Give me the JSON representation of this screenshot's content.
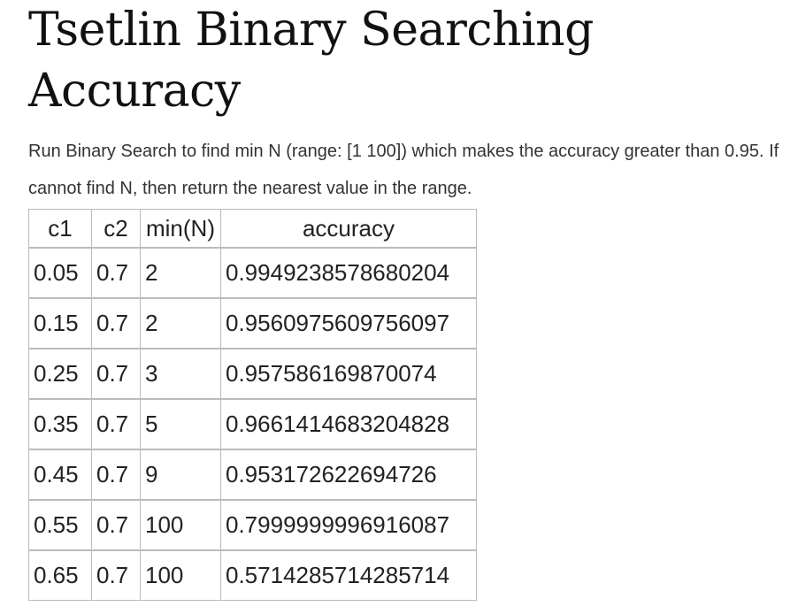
{
  "page": {
    "title": "Tsetlin Binary Searching Accuracy",
    "description": "Run Binary Search to find min N (range: [1 100]) which makes the accuracy greater than 0.95. If cannot find N, then return the nearest value in the range."
  },
  "table": {
    "headers": [
      "c1",
      "c2",
      "min(N)",
      "accuracy"
    ],
    "rows": [
      [
        "0.05",
        "0.7",
        "2",
        "0.9949238578680204"
      ],
      [
        "0.15",
        "0.7",
        "2",
        "0.9560975609756097"
      ],
      [
        "0.25",
        "0.7",
        "3",
        "0.957586169870074"
      ],
      [
        "0.35",
        "0.7",
        "5",
        "0.9661414683204828"
      ],
      [
        "0.45",
        "0.7",
        "9",
        "0.953172622694726"
      ],
      [
        "0.55",
        "0.7",
        "100",
        "0.7999999996916087"
      ],
      [
        "0.65",
        "0.7",
        "100",
        "0.5714285714285714"
      ]
    ]
  }
}
